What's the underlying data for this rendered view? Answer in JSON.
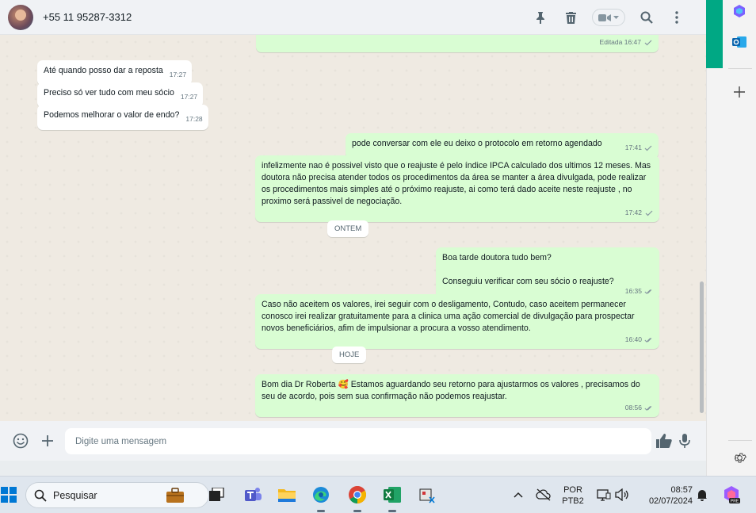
{
  "header": {
    "contact_name": "+55 11 95287-3312",
    "icons": [
      "pin-icon",
      "trash-icon",
      "video-icon",
      "search-icon",
      "menu-icon"
    ]
  },
  "messages": [
    {
      "dir": "out",
      "text": "",
      "time": "Editada 16:47",
      "ticks": "single"
    },
    {
      "dir": "in",
      "text": "Até quando posso dar a reposta",
      "time": "17:27"
    },
    {
      "dir": "in",
      "text": "Preciso só ver tudo com meu sócio",
      "time": "17:27"
    },
    {
      "dir": "in",
      "text": "Podemos melhorar o valor de endo?",
      "time": "17:28"
    },
    {
      "dir": "out",
      "text": "pode conversar com ele eu deixo o protocolo em retorno agendado",
      "time": "17:41",
      "ticks": "single"
    },
    {
      "dir": "out",
      "text": "infelizmente nao é possivel visto que o reajuste é pelo índice IPCA calculado dos ultimos 12 meses. Mas doutora não precisa atender todos os procedimentos da área se manter a área divulgada, pode realizar os procedimentos mais simples até o próximo reajuste, ai como terá dado aceite neste reajuste , no proximo será passivel de negociação.",
      "time": "17:42",
      "ticks": "single"
    },
    {
      "dir": "out",
      "text_lines": [
        "Boa tarde doutora tudo bem?",
        "",
        "Conseguiu verificar com seu sócio o reajuste?"
      ],
      "time": "16:35",
      "ticks": "double"
    },
    {
      "dir": "out",
      "text": "Caso não aceitem os valores, irei seguir com o desligamento, Contudo, caso aceitem permanecer conosco irei realizar gratuitamente para a clinica uma ação comercial de divulgação para prospectar novos beneficiários, afim de impulsionar a procura a vosso atendimento.",
      "time": "16:40",
      "ticks": "double"
    },
    {
      "dir": "out",
      "text_before_emoji": "Bom dia Dr Roberta ",
      "emoji": "🥰",
      "text_after_emoji": " Estamos aguardando seu retorno para ajustarmos os valores , precisamos do seu de acordo, pois sem sua confirmação não podemos reajustar.",
      "time": "08:56",
      "ticks": "double"
    }
  ],
  "date_separators": {
    "ontem": "ONTEM",
    "hoje": "HOJE"
  },
  "composer": {
    "placeholder": "Digite uma mensagem"
  },
  "taskbar": {
    "search_label": "Pesquisar",
    "language_top": "POR",
    "language_bottom": "PTB2",
    "time": "08:57",
    "date": "02/07/2024"
  },
  "colors": {
    "accent": "#00a884",
    "outgoing_bubble": "#d9fdd3",
    "incoming_bubble": "#ffffff",
    "chat_bg": "#efeae2",
    "read_tick": "#8696a0"
  }
}
